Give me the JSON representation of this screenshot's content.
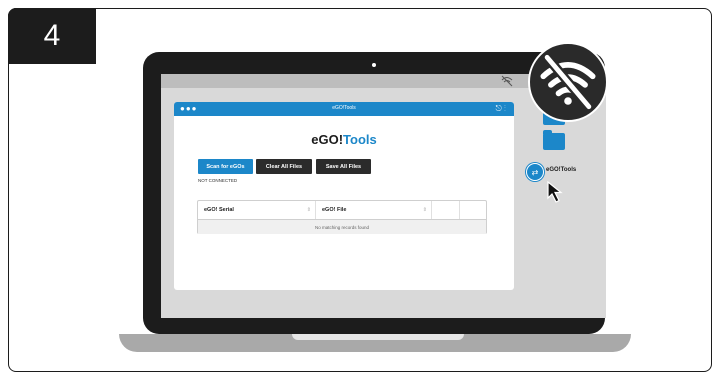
{
  "step": {
    "number": "4"
  },
  "app": {
    "window_title": "eGO!Tools",
    "heading_main": "eGO!",
    "heading_accent": "Tools",
    "buttons": {
      "scan": "Scan for eGOs",
      "clear": "Clear All Files",
      "save": "Save All Files"
    },
    "status": "NOT CONNECTED",
    "table": {
      "columns": [
        "eGO! Serial",
        "eGO! File"
      ],
      "empty_message": "No matching records found"
    }
  },
  "desktop": {
    "app_label": "eGO!Tools"
  },
  "colors": {
    "accent": "#1c87c9",
    "dark": "#1c1c1c",
    "screen_bg": "#d9d9d9"
  },
  "icons": [
    "wifi-off-icon",
    "folder-icon",
    "app-icon",
    "cursor-icon"
  ]
}
